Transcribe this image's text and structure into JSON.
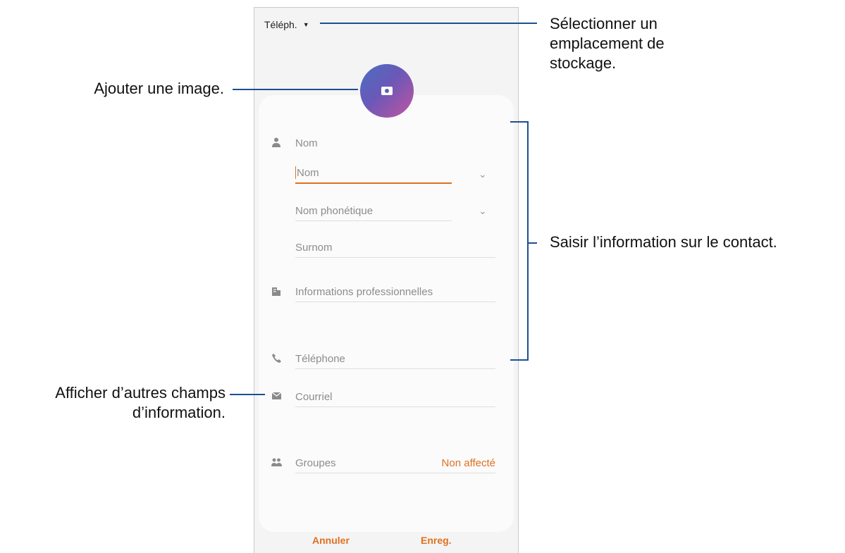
{
  "phone": {
    "storage_label": "Téléph.",
    "fields": {
      "name_section": "Nom",
      "name_placeholder": "Nom",
      "phonetic_placeholder": "Nom phonétique",
      "nickname_placeholder": "Surnom",
      "work_placeholder": "Informations professionnelles",
      "phone_placeholder": "Téléphone",
      "email_placeholder": "Courriel",
      "groups_label": "Groupes",
      "groups_value": "Non affecté"
    },
    "footer": {
      "cancel_label": "Annuler",
      "save_label": "Enreg."
    }
  },
  "annotations": {
    "storage": "Sélectionner un emplacement de stockage.",
    "image": "Ajouter une image.",
    "contact_info": "Saisir l’information sur le contact.",
    "more_fields": "Afficher d’autres champs d’information."
  },
  "icons": {
    "person": "person-icon",
    "business": "business-icon",
    "phone": "phone-icon",
    "email": "email-icon",
    "groups": "groups-icon",
    "camera": "camera-icon"
  },
  "colors": {
    "accent": "#e07020",
    "callout_line": "#1d4f91"
  }
}
